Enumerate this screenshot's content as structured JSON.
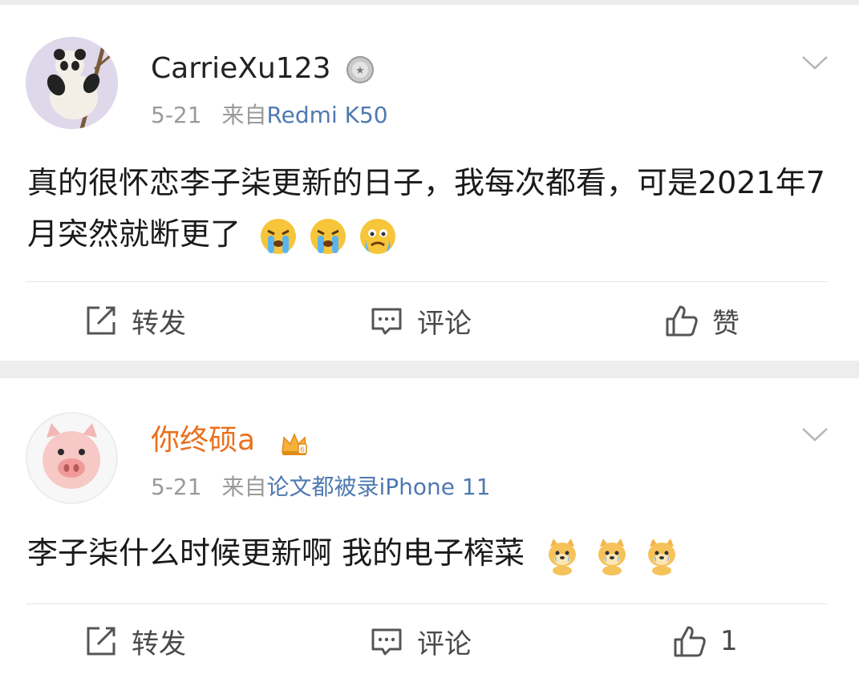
{
  "posts": [
    {
      "username": "CarrieXu123",
      "badge_icon": "silver-medal-icon",
      "date": "5-21",
      "source_prefix": "来自",
      "device": "Redmi K50",
      "text": "真的很怀恋李子柒更新的日子，我每次都看，可是2021年7月突然就断更了",
      "emojis": [
        "crying-face-icon",
        "crying-face-icon",
        "crying-face-icon"
      ],
      "actions": {
        "repost": "转发",
        "comment": "评论",
        "like": "赞"
      }
    },
    {
      "username": "你终硕a",
      "badge_icon": "crown-vip-icon",
      "date": "5-21",
      "source_prefix": "来自",
      "device": "论文都被录iPhone 11",
      "text": "李子柒什么时候更新啊 我的电子榨菜",
      "emojis": [
        "crying-dog-icon",
        "crying-dog-icon",
        "crying-dog-icon"
      ],
      "actions": {
        "repost": "转发",
        "comment": "评论",
        "like": "1"
      }
    }
  ],
  "colors": {
    "vip_name": "#e9701c",
    "device_link": "#4f79b0",
    "meta_gray": "#9a9a9a"
  }
}
